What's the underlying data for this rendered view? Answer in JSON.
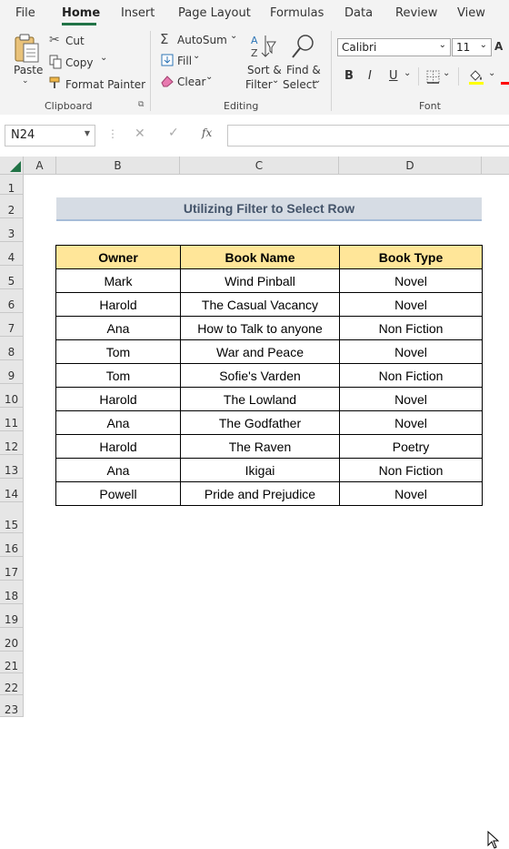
{
  "tabs": [
    "File",
    "Home",
    "Insert",
    "Page Layout",
    "Formulas",
    "Data",
    "Review",
    "View"
  ],
  "active_tab": "Home",
  "clipboard": {
    "paste": "Paste",
    "cut": "Cut",
    "copy": "Copy",
    "format_painter": "Format Painter",
    "group_label": "Clipboard"
  },
  "editing": {
    "autosum": "AutoSum",
    "fill": "Fill",
    "clear": "Clear",
    "sort_filter_line1": "Sort &",
    "sort_filter_line2": "Filter",
    "find_select_line1": "Find &",
    "find_select_line2": "Select",
    "group_label": "Editing"
  },
  "font": {
    "name": "Calibri",
    "size": "11",
    "bold": "B",
    "italic": "I",
    "underline": "U",
    "group_label": "Font"
  },
  "formula_bar": {
    "name_box": "N24",
    "fx": "fx",
    "formula": ""
  },
  "columns": [
    "A",
    "B",
    "C",
    "D"
  ],
  "rows": [
    "1",
    "2",
    "3",
    "4",
    "5",
    "6",
    "7",
    "8",
    "9",
    "10",
    "11",
    "12",
    "13",
    "14",
    "15",
    "16",
    "17",
    "18",
    "19",
    "20",
    "21",
    "22",
    "23"
  ],
  "sheet": {
    "title": "Utilizing Filter to Select Row",
    "headers": [
      "Owner",
      "Book Name",
      "Book Type"
    ],
    "rows": [
      [
        "Mark",
        "Wind Pinball",
        "Novel"
      ],
      [
        "Harold",
        "The Casual Vacancy",
        "Novel"
      ],
      [
        "Ana",
        "How to Talk to anyone",
        "Non Fiction"
      ],
      [
        "Tom",
        "War and Peace",
        "Novel"
      ],
      [
        "Tom",
        "Sofie's Varden",
        "Non Fiction"
      ],
      [
        "Harold",
        "The Lowland",
        "Novel"
      ],
      [
        "Ana",
        "The Godfather",
        "Novel"
      ],
      [
        "Harold",
        "The Raven",
        "Poetry"
      ],
      [
        "Ana",
        "Ikigai",
        "Non Fiction"
      ],
      [
        "Powell",
        "Pride and Prejudice",
        "Novel"
      ]
    ]
  },
  "colors": {
    "accent": "#217346",
    "header_fill": "#ffe699",
    "title_fill": "#d6dce4",
    "title_text": "#44546a"
  }
}
